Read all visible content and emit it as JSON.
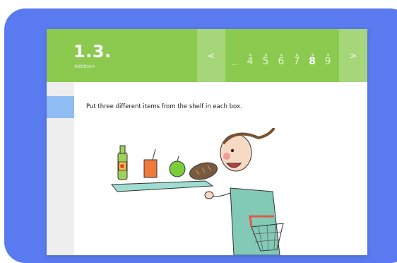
{
  "lesson": {
    "number": "1.3.",
    "title": "Addition"
  },
  "pagination": {
    "prev_label": "<",
    "next_label": ">",
    "ellipsis": "...",
    "pages": [
      "4",
      "5",
      "6",
      "7",
      "8",
      "9"
    ],
    "current": "8"
  },
  "content": {
    "instruction": "Put three different items from the shelf in each box."
  },
  "colors": {
    "frame": "#5a7bf0",
    "header": "#8cc94f",
    "nav_button": "#a6d67a",
    "sidebar_tab": "#8fbcf2"
  },
  "icons": [
    "chevron-left-icon",
    "chevron-right-icon"
  ]
}
